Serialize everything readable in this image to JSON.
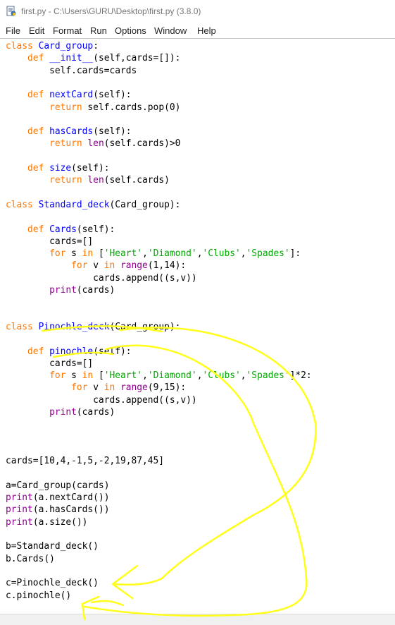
{
  "window": {
    "title": "first.py - C:\\Users\\GURU\\Desktop\\first.py (3.8.0)",
    "icon": "python-file-icon"
  },
  "menu": [
    "File",
    "Edit",
    "Format",
    "Run",
    "Options",
    "Window",
    "Help"
  ],
  "colors": {
    "keyword": "#ff7700",
    "definition": "#0000ff",
    "builtin": "#900090",
    "string": "#00aa00",
    "annotation": "#ffff1a"
  },
  "code_lines": [
    [
      [
        "kw",
        "class "
      ],
      [
        "def",
        "Card_group"
      ],
      [
        "",
        ":"
      ]
    ],
    [
      [
        "",
        "    "
      ],
      [
        "kw",
        "def "
      ],
      [
        "def",
        "__init__"
      ],
      [
        "",
        "(self,cards=[]):"
      ]
    ],
    [
      [
        "",
        "        self.cards=cards"
      ]
    ],
    [],
    [
      [
        "",
        "    "
      ],
      [
        "kw",
        "def "
      ],
      [
        "def",
        "nextCard"
      ],
      [
        "",
        "(self):"
      ]
    ],
    [
      [
        "",
        "        "
      ],
      [
        "kw",
        "return "
      ],
      [
        "",
        "self.cards.pop(0)"
      ]
    ],
    [],
    [
      [
        "",
        "    "
      ],
      [
        "kw",
        "def "
      ],
      [
        "def",
        "hasCards"
      ],
      [
        "",
        "(self):"
      ]
    ],
    [
      [
        "",
        "        "
      ],
      [
        "kw",
        "return "
      ],
      [
        "bi",
        "len"
      ],
      [
        "",
        "(self.cards)>0"
      ]
    ],
    [],
    [
      [
        "",
        "    "
      ],
      [
        "kw",
        "def "
      ],
      [
        "def",
        "size"
      ],
      [
        "",
        "(self):"
      ]
    ],
    [
      [
        "",
        "        "
      ],
      [
        "kw",
        "return "
      ],
      [
        "bi",
        "len"
      ],
      [
        "",
        "(self.cards)"
      ]
    ],
    [],
    [
      [
        "kw",
        "class "
      ],
      [
        "def",
        "Standard_deck"
      ],
      [
        "",
        "(Card_group):"
      ]
    ],
    [],
    [
      [
        "",
        "    "
      ],
      [
        "kw",
        "def "
      ],
      [
        "def",
        "Cards"
      ],
      [
        "",
        "(self):"
      ]
    ],
    [
      [
        "",
        "        cards=[]"
      ]
    ],
    [
      [
        "",
        "        "
      ],
      [
        "kw",
        "for "
      ],
      [
        "",
        "s "
      ],
      [
        "kw",
        "in "
      ],
      [
        "",
        "["
      ],
      [
        "str",
        "'Heart'"
      ],
      [
        "",
        ","
      ],
      [
        "str",
        "'Diamond'"
      ],
      [
        "",
        ","
      ],
      [
        "str",
        "'Clubs'"
      ],
      [
        "",
        ","
      ],
      [
        "str",
        "'Spades'"
      ],
      [
        "",
        "]:"
      ]
    ],
    [
      [
        "",
        "            "
      ],
      [
        "kw",
        "for "
      ],
      [
        "",
        "v "
      ],
      [
        "kw",
        "in "
      ],
      [
        "bi",
        "range"
      ],
      [
        "",
        "(1,14):"
      ]
    ],
    [
      [
        "",
        "                cards.append((s,v))"
      ]
    ],
    [
      [
        "",
        "        "
      ],
      [
        "bi",
        "print"
      ],
      [
        "",
        "(cards)"
      ]
    ],
    [],
    [],
    [
      [
        "kw",
        "class "
      ],
      [
        "def",
        "Pinochle_deck"
      ],
      [
        "",
        "(Card_group):"
      ]
    ],
    [],
    [
      [
        "",
        "    "
      ],
      [
        "kw",
        "def "
      ],
      [
        "def",
        "pinochle"
      ],
      [
        "",
        "(self):"
      ]
    ],
    [
      [
        "",
        "        cards=[]"
      ]
    ],
    [
      [
        "",
        "        "
      ],
      [
        "kw",
        "for "
      ],
      [
        "",
        "s "
      ],
      [
        "kw",
        "in "
      ],
      [
        "",
        "["
      ],
      [
        "str",
        "'Heart'"
      ],
      [
        "",
        ","
      ],
      [
        "str",
        "'Diamond'"
      ],
      [
        "",
        ","
      ],
      [
        "str",
        "'Clubs'"
      ],
      [
        "",
        ","
      ],
      [
        "str",
        "'Spades'"
      ],
      [
        "",
        "]*2:"
      ]
    ],
    [
      [
        "",
        "            "
      ],
      [
        "kw",
        "for "
      ],
      [
        "",
        "v "
      ],
      [
        "kw",
        "in "
      ],
      [
        "bi",
        "range"
      ],
      [
        "",
        "(9,15):"
      ]
    ],
    [
      [
        "",
        "                cards.append((s,v))"
      ]
    ],
    [
      [
        "",
        "        "
      ],
      [
        "bi",
        "print"
      ],
      [
        "",
        "(cards)"
      ]
    ],
    [],
    [],
    [],
    [
      [
        "",
        "cards=[10,4,-1,5,-2,19,87,45]"
      ]
    ],
    [],
    [
      [
        "",
        "a=Card_group(cards)"
      ]
    ],
    [
      [
        "bi",
        "print"
      ],
      [
        "",
        "(a.nextCard())"
      ]
    ],
    [
      [
        "bi",
        "print"
      ],
      [
        "",
        "(a.hasCards())"
      ]
    ],
    [
      [
        "bi",
        "print"
      ],
      [
        "",
        "(a.size())"
      ]
    ],
    [],
    [
      [
        "",
        "b=Standard_deck()"
      ]
    ],
    [
      [
        "",
        "b.Cards()"
      ]
    ],
    [],
    [
      [
        "",
        "c=Pinochle_deck()"
      ]
    ],
    [
      [
        "",
        "c.pinochle()"
      ]
    ]
  ]
}
